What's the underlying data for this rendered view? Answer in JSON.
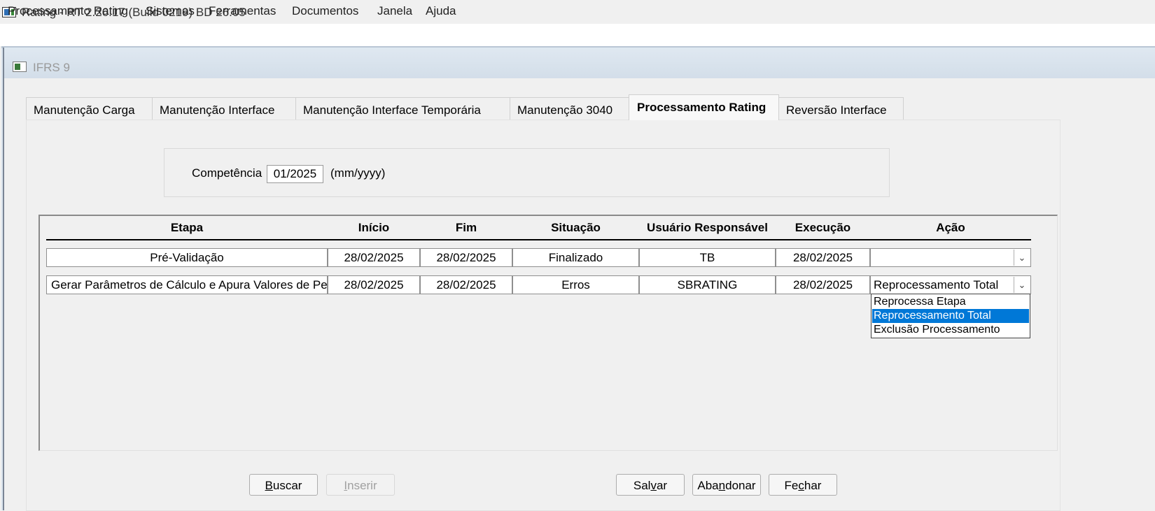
{
  "window": {
    "title": "Rating - RT 2.26.17 (Build 0219) BD 26.05"
  },
  "menu": [
    "Processamento Rating",
    "Sistemas",
    "Ferramentas",
    "Documentos",
    "Janela",
    "Ajuda"
  ],
  "child_window": {
    "title": "IFRS 9"
  },
  "tabs": [
    {
      "label": "Manutenção Carga",
      "active": false
    },
    {
      "label": "Manutenção Interface",
      "active": false
    },
    {
      "label": "Manutenção Interface Temporária",
      "active": false
    },
    {
      "label": "Manutenção 3040",
      "active": false
    },
    {
      "label": "Processamento Rating",
      "active": true
    },
    {
      "label": "Reversão Interface",
      "active": false
    }
  ],
  "competencia": {
    "label": "Competência",
    "value": "01/2025",
    "hint": "(mm/yyyy)"
  },
  "grid": {
    "headers": [
      "Etapa",
      "Início",
      "Fim",
      "Situação",
      "Usuário Responsável",
      "Execução",
      "Ação"
    ],
    "rows": [
      {
        "etapa": "Pré-Validação",
        "inicio": "28/02/2025",
        "fim": "28/02/2025",
        "situacao": "Finalizado",
        "usuario": "TB",
        "execucao": "28/02/2025",
        "acao": ""
      },
      {
        "etapa": "Gerar Parâmetros de Cálculo e Apura Valores de Perda",
        "inicio": "28/02/2025",
        "fim": "28/02/2025",
        "situacao": "Erros",
        "usuario": "SBRATING",
        "execucao": "28/02/2025",
        "acao": "Reprocessamento Total"
      }
    ]
  },
  "dropdown": {
    "options": [
      "Reprocessa Etapa",
      "Reprocessamento Total",
      "Exclusão Processamento"
    ],
    "selected": "Reprocessamento Total"
  },
  "buttons": {
    "buscar": {
      "pre": "",
      "accel": "B",
      "post": "uscar",
      "enabled": true
    },
    "inserir": {
      "pre": "",
      "accel": "I",
      "post": "nserir",
      "enabled": false
    },
    "salvar": {
      "pre": "Sal",
      "accel": "v",
      "post": "ar",
      "enabled": true
    },
    "abandonar": {
      "pre": "Aba",
      "accel": "n",
      "post": "donar",
      "enabled": true
    },
    "fechar": {
      "pre": "Fe",
      "accel": "c",
      "post": "har",
      "enabled": true
    }
  },
  "icons": {
    "app": "window-app-icon",
    "child": "window-app-icon",
    "combo": "chevron-down-icon"
  },
  "colors": {
    "selection": "#0078d7",
    "mdi_title": "#d3dee9"
  }
}
